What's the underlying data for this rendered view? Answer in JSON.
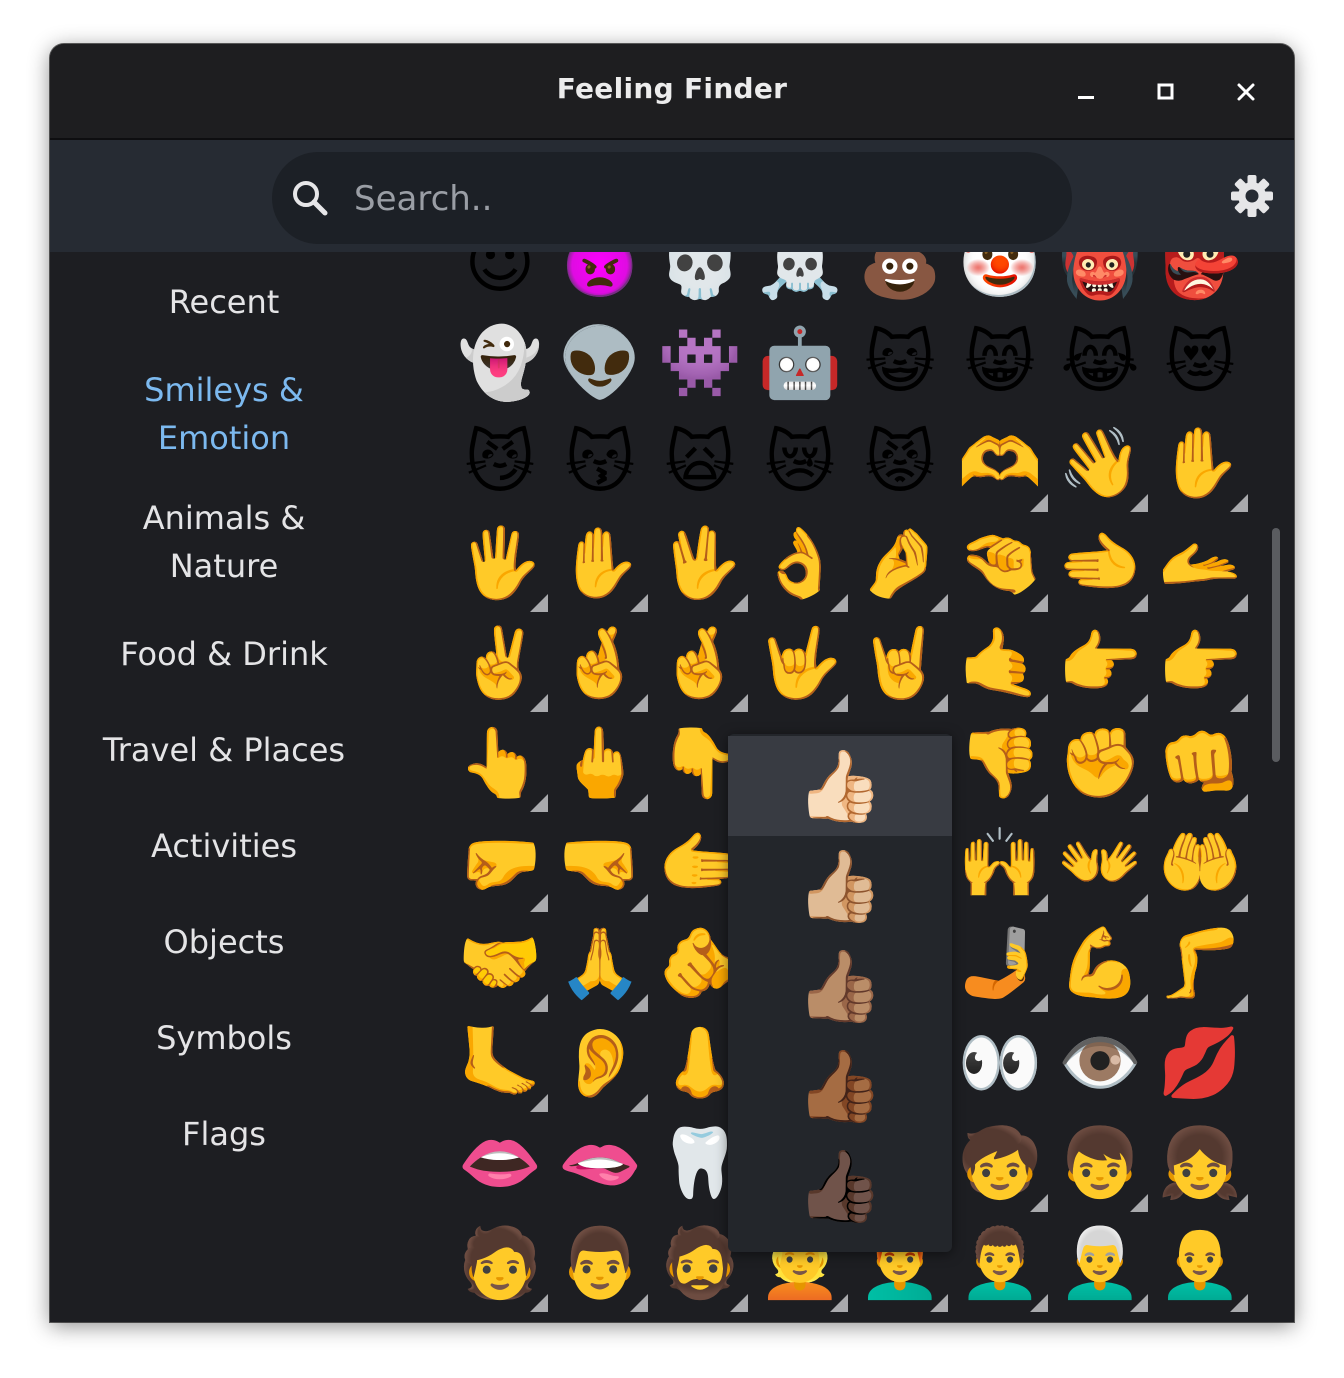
{
  "window": {
    "title": "Feeling Finder"
  },
  "search": {
    "placeholder": "Search.."
  },
  "sidebar": {
    "items": [
      {
        "label": "Recent",
        "active": false
      },
      {
        "label": "Smileys & Emotion",
        "active": true
      },
      {
        "label": "Animals & Nature",
        "active": false
      },
      {
        "label": "Food & Drink",
        "active": false
      },
      {
        "label": "Travel & Places",
        "active": false
      },
      {
        "label": "Activities",
        "active": false
      },
      {
        "label": "Objects",
        "active": false
      },
      {
        "label": "Symbols",
        "active": false
      },
      {
        "label": "Flags",
        "active": false
      }
    ]
  },
  "emoji_rows": [
    [
      {
        "e": "😈",
        "v": false
      },
      {
        "e": "👿",
        "v": false
      },
      {
        "e": "💀",
        "v": false
      },
      {
        "e": "☠️",
        "v": false
      },
      {
        "e": "💩",
        "v": false
      },
      {
        "e": "🤡",
        "v": false
      },
      {
        "e": "👹",
        "v": false
      },
      {
        "e": "👺",
        "v": false
      }
    ],
    [
      {
        "e": "👻",
        "v": false
      },
      {
        "e": "👽",
        "v": false
      },
      {
        "e": "👾",
        "v": false
      },
      {
        "e": "🤖",
        "v": false
      },
      {
        "e": "😺",
        "v": false
      },
      {
        "e": "😸",
        "v": false
      },
      {
        "e": "😹",
        "v": false
      },
      {
        "e": "😻",
        "v": false
      }
    ],
    [
      {
        "e": "😼",
        "v": false
      },
      {
        "e": "😽",
        "v": false
      },
      {
        "e": "🙀",
        "v": false
      },
      {
        "e": "😿",
        "v": false
      },
      {
        "e": "😾",
        "v": false
      },
      {
        "e": "🫶",
        "v": true
      },
      {
        "e": "👋",
        "v": true
      },
      {
        "e": "✋",
        "v": true
      }
    ],
    [
      {
        "e": "🖐️",
        "v": true
      },
      {
        "e": "✋",
        "v": true
      },
      {
        "e": "🖖",
        "v": true
      },
      {
        "e": "👌",
        "v": true
      },
      {
        "e": "🤌",
        "v": true
      },
      {
        "e": "🤏",
        "v": true
      },
      {
        "e": "🫲",
        "v": true
      },
      {
        "e": "🫴",
        "v": true
      }
    ],
    [
      {
        "e": "✌️",
        "v": true
      },
      {
        "e": "🤞",
        "v": true
      },
      {
        "e": "🤞",
        "v": true
      },
      {
        "e": "🤟",
        "v": true
      },
      {
        "e": "🤘",
        "v": true
      },
      {
        "e": "🤙",
        "v": true
      },
      {
        "e": "👉",
        "v": true
      },
      {
        "e": "👉",
        "v": true
      }
    ],
    [
      {
        "e": "👆",
        "v": true
      },
      {
        "e": "🖕",
        "v": true
      },
      {
        "e": "👇",
        "v": true
      },
      {
        "e": "",
        "v": false
      },
      {
        "e": "",
        "v": false
      },
      {
        "e": "👎",
        "v": true
      },
      {
        "e": "✊",
        "v": true
      },
      {
        "e": "👊",
        "v": true
      }
    ],
    [
      {
        "e": "🤛",
        "v": true
      },
      {
        "e": "🤜",
        "v": true
      },
      {
        "e": "🫱",
        "v": true
      },
      {
        "e": "",
        "v": false
      },
      {
        "e": "",
        "v": false
      },
      {
        "e": "🙌",
        "v": true
      },
      {
        "e": "👐",
        "v": true
      },
      {
        "e": "🤲",
        "v": true
      }
    ],
    [
      {
        "e": "🤝",
        "v": true
      },
      {
        "e": "🙏",
        "v": true
      },
      {
        "e": "🫵",
        "v": true
      },
      {
        "e": "",
        "v": false
      },
      {
        "e": "",
        "v": false
      },
      {
        "e": "🤳",
        "v": true
      },
      {
        "e": "💪",
        "v": true
      },
      {
        "e": "🦵",
        "v": true
      }
    ],
    [
      {
        "e": "🦶",
        "v": true
      },
      {
        "e": "👂",
        "v": true
      },
      {
        "e": "👃",
        "v": true
      },
      {
        "e": "",
        "v": false
      },
      {
        "e": "",
        "v": false
      },
      {
        "e": "👀",
        "v": false
      },
      {
        "e": "👁️",
        "v": false
      },
      {
        "e": "💋",
        "v": false
      }
    ],
    [
      {
        "e": "👄",
        "v": false
      },
      {
        "e": "🫦",
        "v": false
      },
      {
        "e": "🦷",
        "v": false
      },
      {
        "e": "",
        "v": false
      },
      {
        "e": "",
        "v": false
      },
      {
        "e": "🧒",
        "v": true
      },
      {
        "e": "👦",
        "v": true
      },
      {
        "e": "👧",
        "v": true
      }
    ],
    [
      {
        "e": "🧑",
        "v": true
      },
      {
        "e": "👨",
        "v": true
      },
      {
        "e": "🧔",
        "v": true
      },
      {
        "e": "👱",
        "v": true
      },
      {
        "e": "👨‍🦰",
        "v": true
      },
      {
        "e": "👨‍🦱",
        "v": true
      },
      {
        "e": "👨‍🦳",
        "v": true
      },
      {
        "e": "👨‍🦲",
        "v": true
      }
    ]
  ],
  "skin_tone_popover": {
    "base": "👍",
    "options": [
      "👍🏻",
      "👍🏼",
      "👍🏽",
      "👍🏾",
      "👍🏿"
    ],
    "selected_index": 0
  },
  "colors": {
    "accent": "#7cb9ef",
    "background": "#1d1e22",
    "toolbar": "#262b33"
  }
}
